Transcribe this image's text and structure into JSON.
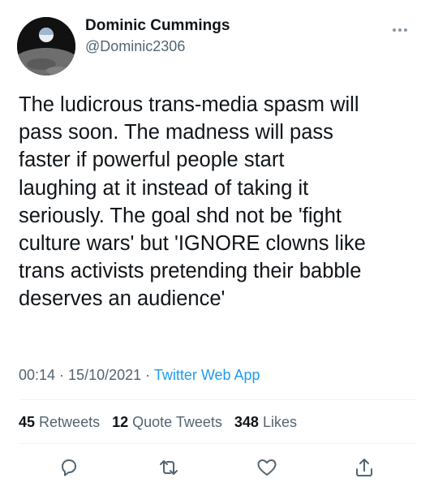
{
  "tweet": {
    "author_name": "Dominic Cummings",
    "author_handle": "@Dominic2306",
    "text": "The ludicrous trans-media spasm will\npass soon. The madness will pass\nfaster if powerful people start\nlaughing at it instead of taking it\nseriously. The goal shd not be 'fight\nculture wars' but 'IGNORE clowns like\ntrans activists pretending their babble\ndeserves an audience'",
    "time": "00:14",
    "date": "15/10/2021",
    "separator": " · ",
    "source": "Twitter Web App",
    "avatar_icon": "earthrise-photo",
    "more_icon": "more-horizontal-icon"
  },
  "stats": {
    "retweets_count": "45",
    "retweets_label": "Retweets",
    "quotes_count": "12",
    "quotes_label": "Quote Tweets",
    "likes_count": "348",
    "likes_label": "Likes"
  },
  "actions": [
    "reply-icon",
    "retweet-icon",
    "like-icon",
    "share-icon"
  ],
  "colors": {
    "text": "#0f1419",
    "secondary": "#536471",
    "link": "#1d9bf0",
    "divider": "#eff3f4"
  }
}
